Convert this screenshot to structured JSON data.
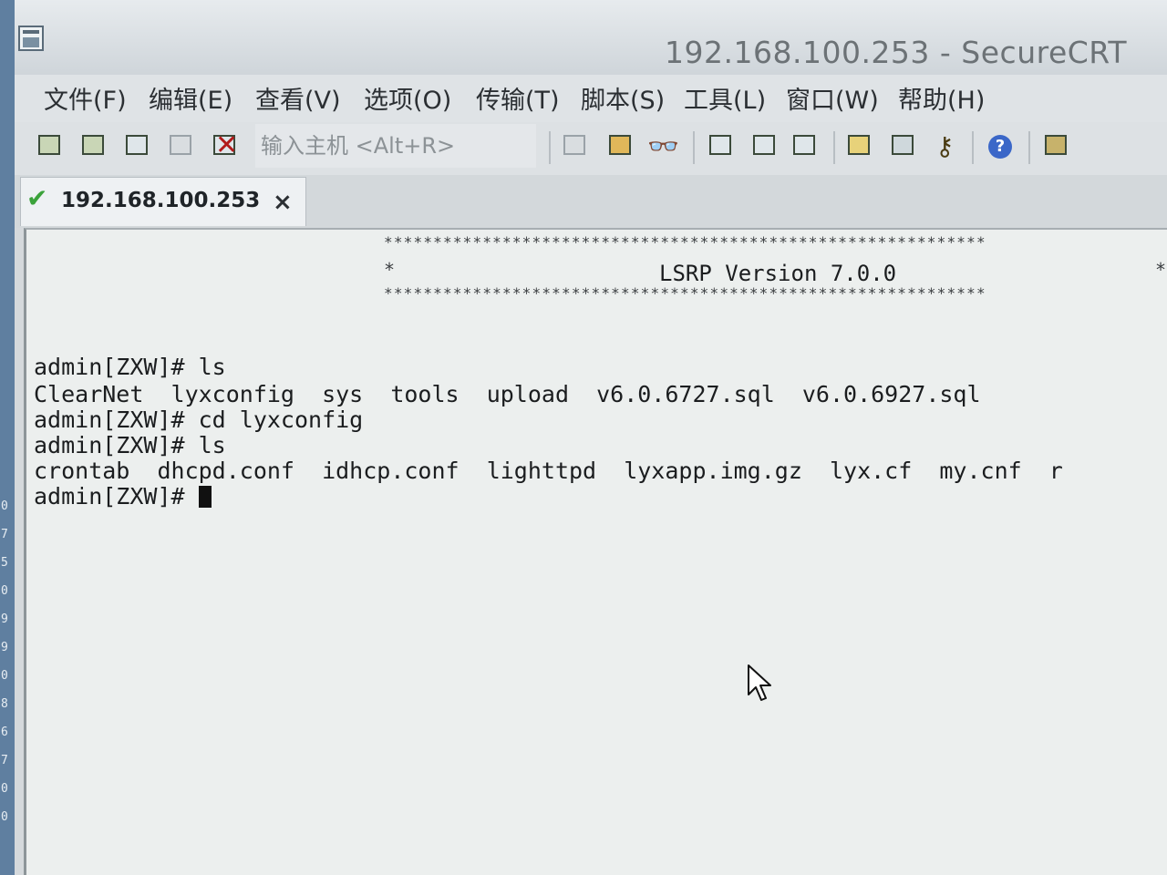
{
  "window": {
    "title": "192.168.100.253 - SecureCRT"
  },
  "menu": [
    {
      "label": "文件(F)"
    },
    {
      "label": "编辑(E)"
    },
    {
      "label": "查看(V)"
    },
    {
      "label": "选项(O)"
    },
    {
      "label": "传输(T)"
    },
    {
      "label": "脚本(S)"
    },
    {
      "label": "工具(L)"
    },
    {
      "label": "窗口(W)"
    },
    {
      "label": "帮助(H)"
    }
  ],
  "toolbar": {
    "quick_connect_placeholder": "输入主机 <Alt+R>",
    "buttons_left": [
      "connect-icon",
      "quick-connect-icon",
      "connect-tab-icon",
      "reconnect-icon",
      "disconnect-icon"
    ],
    "buttons_right": [
      "copy-icon",
      "paste-icon",
      "find-icon",
      "print-screen-icon",
      "print-selection-icon",
      "print-icon",
      "session-options-icon",
      "global-options-icon",
      "keymap-icon",
      "help-icon",
      "sftp-icon"
    ]
  },
  "tabs": [
    {
      "label": "192.168.100.253",
      "close": "×",
      "status_icon": "connected-check-icon"
    }
  ],
  "terminal": {
    "banner_stars": "*************************************************************",
    "banner_left_star": "*",
    "banner_title": "LSRP Version 7.0.0",
    "banner_right_star": "*",
    "lines": [
      "admin[ZXW]# ls",
      "ClearNet  lyxconfig  sys  tools  upload  v6.0.6727.sql  v6.0.6927.sql",
      "admin[ZXW]# cd lyxconfig",
      "admin[ZXW]# ls",
      "crontab  dhcpd.conf  idhcp.conf  lighttpd  lyxapp.img.gz  lyx.cf  my.cnf  r"
    ],
    "prompt": "admin[ZXW]# "
  },
  "left_edge_digits": "0\n7\n5\n0\n9\n9\n0\n8\n6\n7\n0\n0"
}
